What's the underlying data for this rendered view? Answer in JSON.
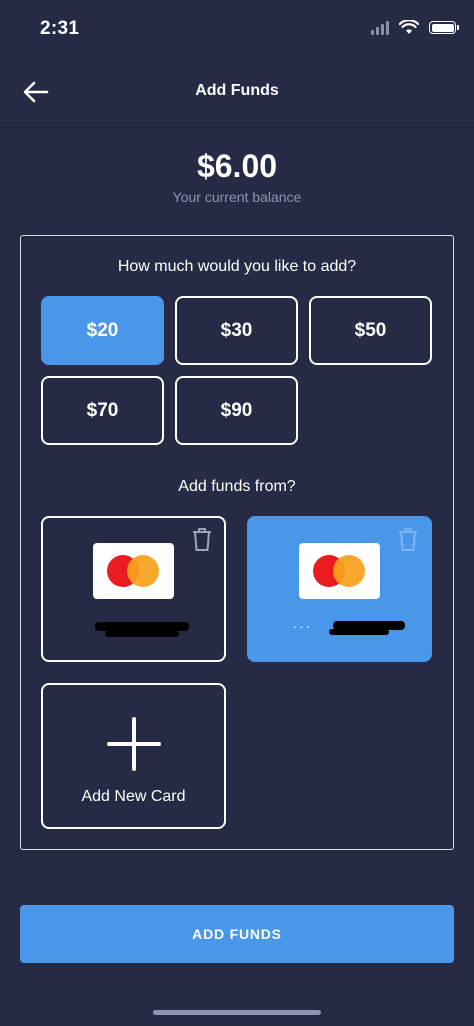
{
  "status_bar": {
    "time": "2:31"
  },
  "header": {
    "title": "Add Funds",
    "back_icon": "arrow-left-icon"
  },
  "balance": {
    "amount": "$6.00",
    "label": "Your current balance"
  },
  "amount_section": {
    "question": "How much would you like to add?",
    "options": [
      {
        "label": "$20",
        "selected": true
      },
      {
        "label": "$30",
        "selected": false
      },
      {
        "label": "$50",
        "selected": false
      },
      {
        "label": "$70",
        "selected": false
      },
      {
        "label": "$90",
        "selected": false
      }
    ]
  },
  "source_section": {
    "question": "Add funds from?",
    "cards": [
      {
        "brand_icon": "mastercard-icon",
        "number": "",
        "selected": false
      },
      {
        "brand_icon": "mastercard-icon",
        "number": "···",
        "selected": true
      }
    ],
    "add_card_label": "Add New Card"
  },
  "primary_button": {
    "label": "ADD FUNDS"
  },
  "colors": {
    "background": "#262a44",
    "accent": "#4a97ea",
    "muted_text": "#8f94b2",
    "mastercard_red": "#eb1c1f",
    "mastercard_orange": "#f7a21b"
  }
}
